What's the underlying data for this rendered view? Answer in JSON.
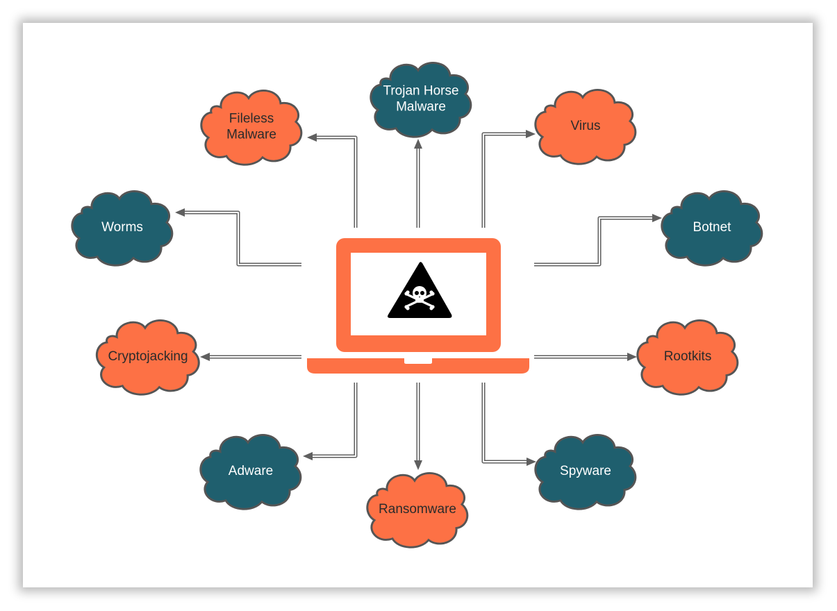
{
  "diagram": {
    "title": "",
    "colors": {
      "orange": "#fd7145",
      "teal": "#1f5f6e",
      "outline": "#555555",
      "connector": "#5f5f5f",
      "laptop": "#fd7145",
      "warning": "#000000"
    },
    "center": {
      "label": "Infected laptop",
      "icon": "skull-crossbones-warning-icon"
    },
    "nodes": [
      {
        "id": "fileless-malware",
        "lines": [
          "Fileless",
          "Malware"
        ],
        "color": "orange"
      },
      {
        "id": "trojan-horse-malware",
        "lines": [
          "Trojan Horse",
          "Malware"
        ],
        "color": "teal"
      },
      {
        "id": "virus",
        "lines": [
          "Virus"
        ],
        "color": "orange"
      },
      {
        "id": "worms",
        "lines": [
          "Worms"
        ],
        "color": "teal"
      },
      {
        "id": "botnet",
        "lines": [
          "Botnet"
        ],
        "color": "teal"
      },
      {
        "id": "cryptojacking",
        "lines": [
          "Cryptojacking"
        ],
        "color": "orange"
      },
      {
        "id": "rootkits",
        "lines": [
          "Rootkits"
        ],
        "color": "orange"
      },
      {
        "id": "adware",
        "lines": [
          "Adware"
        ],
        "color": "teal"
      },
      {
        "id": "ransomware",
        "lines": [
          "Ransomware"
        ],
        "color": "orange"
      },
      {
        "id": "spyware",
        "lines": [
          "Spyware"
        ],
        "color": "teal"
      }
    ],
    "edges": [
      {
        "from": "center",
        "to": "fileless-malware"
      },
      {
        "from": "center",
        "to": "trojan-horse-malware"
      },
      {
        "from": "center",
        "to": "virus"
      },
      {
        "from": "center",
        "to": "worms"
      },
      {
        "from": "center",
        "to": "botnet"
      },
      {
        "from": "center",
        "to": "cryptojacking"
      },
      {
        "from": "center",
        "to": "rootkits"
      },
      {
        "from": "center",
        "to": "adware"
      },
      {
        "from": "center",
        "to": "ransomware"
      },
      {
        "from": "center",
        "to": "spyware"
      }
    ]
  }
}
